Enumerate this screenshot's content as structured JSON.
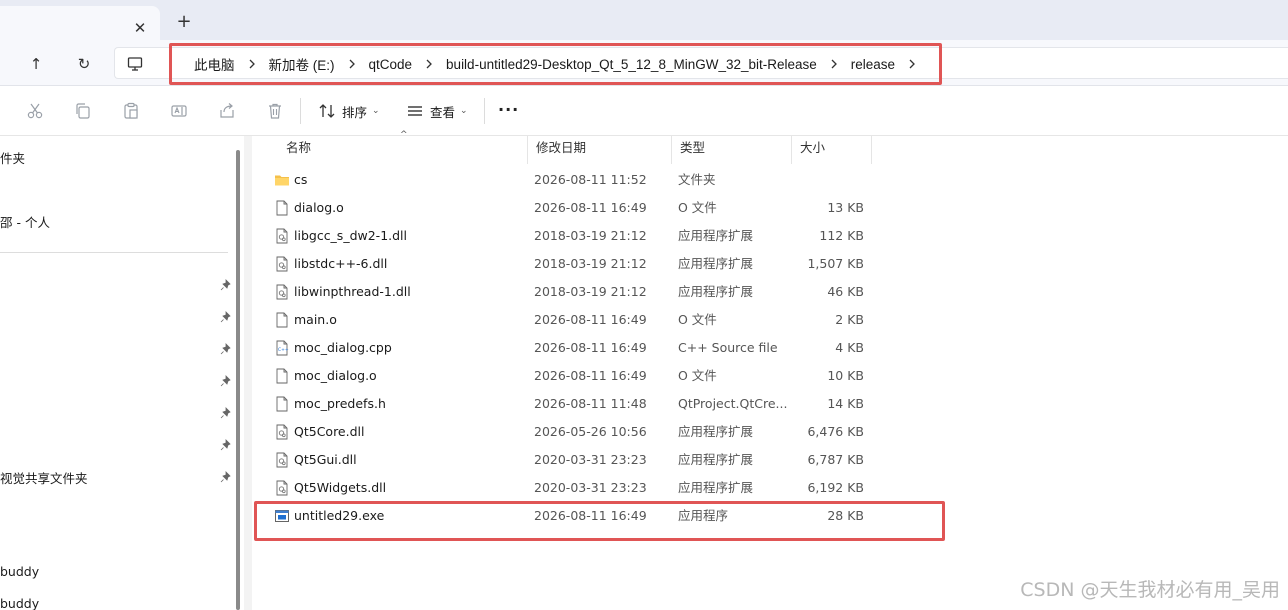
{
  "tab": {
    "close": "✕",
    "new_tab": "+"
  },
  "nav": {
    "up": "↑",
    "refresh": "↻"
  },
  "breadcrumbs": [
    "此电脑",
    "新加卷 (E:)",
    "qtCode",
    "build-untitled29-Desktop_Qt_5_12_8_MinGW_32_bit-Release",
    "release"
  ],
  "toolbar": {
    "icons": [
      "cut-icon",
      "copy-icon",
      "paste-icon",
      "rename-icon",
      "share-icon",
      "delete-icon"
    ],
    "sort_label": "排序",
    "view_label": "查看",
    "more_label": "···"
  },
  "sidebar": {
    "items": [
      "件夹",
      "- 个人",
      "视觉共享文件夹",
      "buddy",
      "buddy"
    ],
    "partial_prefix": "邵"
  },
  "columns": {
    "name": "名称",
    "date": "修改日期",
    "type": "类型",
    "size": "大小"
  },
  "files": [
    {
      "name": "cs",
      "date": "2026-08-11 11:52",
      "type": "文件夹",
      "size": "",
      "icon": "folder-icon"
    },
    {
      "name": "dialog.o",
      "date": "2026-08-11 16:49",
      "type": "O 文件",
      "size": "13 KB",
      "icon": "file-icon"
    },
    {
      "name": "libgcc_s_dw2-1.dll",
      "date": "2018-03-19 21:12",
      "type": "应用程序扩展",
      "size": "112 KB",
      "icon": "dll-icon"
    },
    {
      "name": "libstdc++-6.dll",
      "date": "2018-03-19 21:12",
      "type": "应用程序扩展",
      "size": "1,507 KB",
      "icon": "dll-icon"
    },
    {
      "name": "libwinpthread-1.dll",
      "date": "2018-03-19 21:12",
      "type": "应用程序扩展",
      "size": "46 KB",
      "icon": "dll-icon"
    },
    {
      "name": "main.o",
      "date": "2026-08-11 16:49",
      "type": "O 文件",
      "size": "2 KB",
      "icon": "file-icon"
    },
    {
      "name": "moc_dialog.cpp",
      "date": "2026-08-11 16:49",
      "type": "C++ Source file",
      "size": "4 KB",
      "icon": "cpp-file-icon"
    },
    {
      "name": "moc_dialog.o",
      "date": "2026-08-11 16:49",
      "type": "O 文件",
      "size": "10 KB",
      "icon": "file-icon"
    },
    {
      "name": "moc_predefs.h",
      "date": "2026-08-11 11:48",
      "type": "QtProject.QtCre...",
      "size": "14 KB",
      "icon": "file-icon"
    },
    {
      "name": "Qt5Core.dll",
      "date": "2026-05-26 10:56",
      "type": "应用程序扩展",
      "size": "6,476 KB",
      "icon": "dll-icon"
    },
    {
      "name": "Qt5Gui.dll",
      "date": "2020-03-31 23:23",
      "type": "应用程序扩展",
      "size": "6,787 KB",
      "icon": "dll-icon"
    },
    {
      "name": "Qt5Widgets.dll",
      "date": "2020-03-31 23:23",
      "type": "应用程序扩展",
      "size": "6,192 KB",
      "icon": "dll-icon"
    },
    {
      "name": "untitled29.exe",
      "date": "2026-08-11 16:49",
      "type": "应用程序",
      "size": "28 KB",
      "icon": "exe-icon"
    }
  ],
  "colors": {
    "highlight": "#e05555",
    "folder": "#f5c04a",
    "accent": "#1e6fd1"
  },
  "watermark": "CSDN @天生我材必有用_吴用"
}
